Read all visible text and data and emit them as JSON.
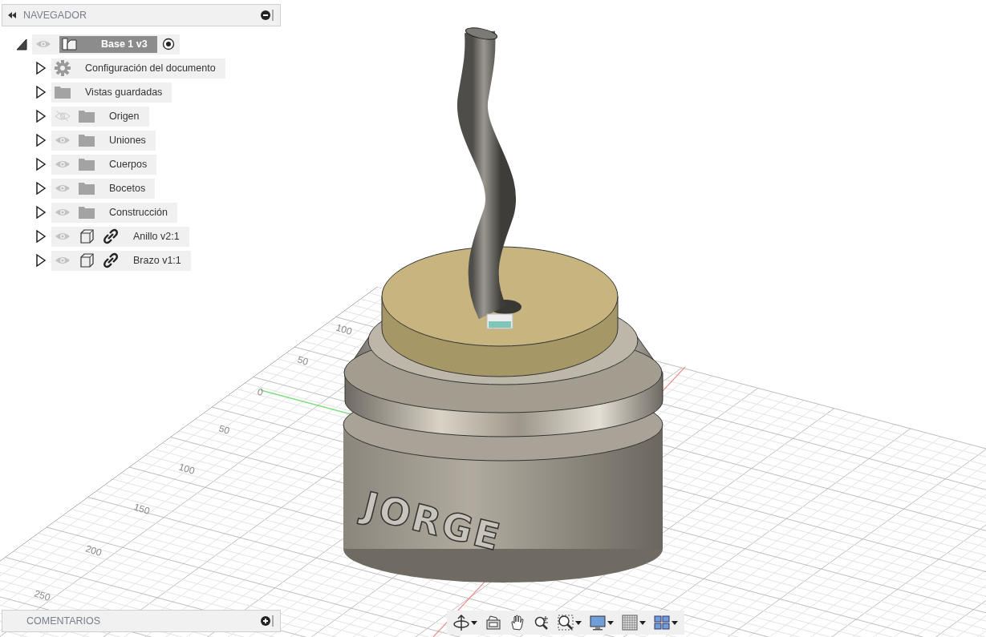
{
  "navigator": {
    "title": "NAVEGADOR",
    "tree": [
      {
        "label": "Base 1 v3",
        "kind": "root",
        "expanded": true,
        "visible": true,
        "selected": true,
        "active": true,
        "children": [
          {
            "label": "Configuración del documento",
            "kind": "settings",
            "expanded": false,
            "selected": false
          },
          {
            "label": "Vistas guardadas",
            "kind": "folder",
            "expanded": false,
            "selected": false
          },
          {
            "label": "Origen",
            "kind": "folder",
            "expanded": false,
            "visible": false,
            "selected": false
          },
          {
            "label": "Uniones",
            "kind": "folder",
            "expanded": false,
            "visible": true,
            "selected": false
          },
          {
            "label": "Cuerpos",
            "kind": "folder",
            "expanded": false,
            "visible": true,
            "selected": false
          },
          {
            "label": "Bocetos",
            "kind": "folder",
            "expanded": false,
            "visible": true,
            "selected": false
          },
          {
            "label": "Construcción",
            "kind": "folder",
            "expanded": false,
            "visible": true,
            "selected": false
          },
          {
            "label": "Anillo v2:1",
            "kind": "linked-component",
            "expanded": false,
            "visible": true,
            "selected": false
          },
          {
            "label": "Brazo v1:1",
            "kind": "linked-component",
            "expanded": false,
            "visible": true,
            "selected": false
          }
        ]
      }
    ]
  },
  "viewport": {
    "grid_labels": [
      "100",
      "50",
      "0",
      "50",
      "100",
      "150",
      "200",
      "250"
    ],
    "model_text": "JORGE"
  },
  "comments": {
    "title": "COMENTARIOS"
  },
  "toolbar": [
    {
      "kind": "orbit",
      "dropdown": true
    },
    {
      "kind": "look-at",
      "dropdown": false
    },
    {
      "kind": "pan",
      "dropdown": false
    },
    {
      "kind": "zoom",
      "dropdown": false
    },
    {
      "kind": "fit",
      "dropdown": true
    },
    {
      "kind": "display",
      "dropdown": true
    },
    {
      "kind": "grid",
      "dropdown": true
    },
    {
      "kind": "viewports",
      "dropdown": true
    }
  ]
}
